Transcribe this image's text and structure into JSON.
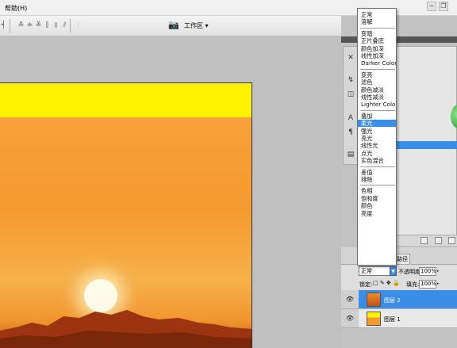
{
  "menubar": {
    "help_label": "帮助(H)"
  },
  "toolbar": {
    "workspace_label": "工作区 ▾"
  },
  "blend_menu": {
    "groups": [
      [
        "正常",
        "溶解"
      ],
      [
        "变暗",
        "正片叠底",
        "颜色加深",
        "线性加深",
        "Darker Color"
      ],
      [
        "变亮",
        "滤色",
        "颜色减淡",
        "线性减淡",
        "Lighter Color"
      ],
      [
        "叠加",
        "柔光",
        "强光",
        "亮光",
        "线性光",
        "点光",
        "实色混合"
      ],
      [
        "差值",
        "排除"
      ],
      [
        "色相",
        "饱和度",
        "颜色",
        "亮度"
      ]
    ],
    "highlighted": "柔光"
  },
  "layers": {
    "tab_label": "路径",
    "blend_mode": "正常",
    "opacity_label": "不透明度:",
    "opacity_value": "100%",
    "lock_label": "锁定:",
    "fill_label": "填充:",
    "fill_value": "100%",
    "items": [
      {
        "name": "图层 2",
        "active": true
      },
      {
        "name": "图层 1",
        "active": false
      }
    ]
  },
  "colors": {
    "selection": "#3b8ee8",
    "doc_yellow": "#fff200",
    "photo_orange": "#f59a2e"
  }
}
